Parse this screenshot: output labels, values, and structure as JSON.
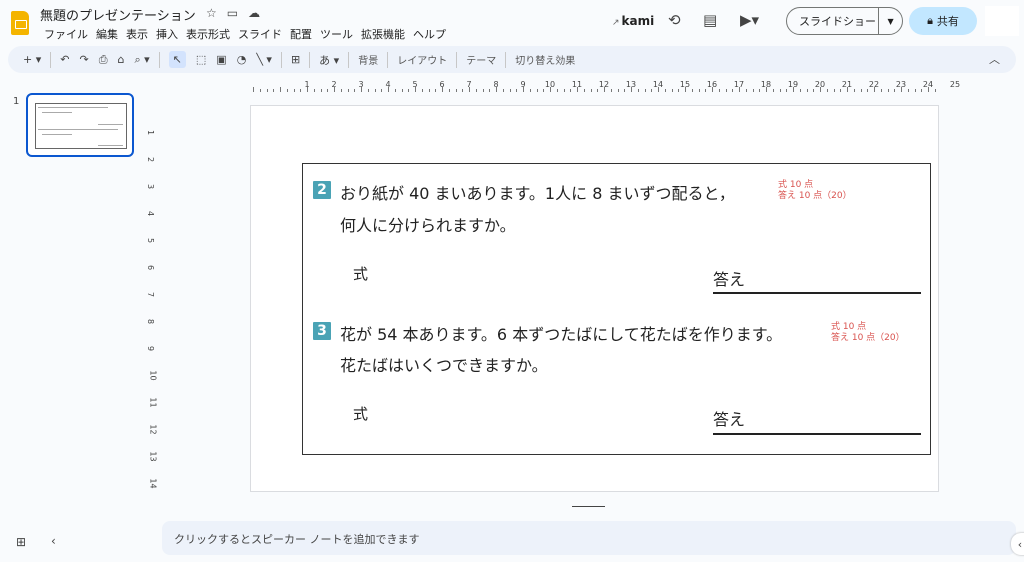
{
  "header": {
    "title": "無題のプレゼンテーション",
    "menu": [
      "ファイル",
      "編集",
      "表示",
      "挿入",
      "表示形式",
      "スライド",
      "配置",
      "ツール",
      "拡張機能",
      "ヘルプ"
    ],
    "kami_label": "kami",
    "slideshow_label": "スライドショー",
    "share_label": "共有"
  },
  "toolbar": {
    "background_label": "背景",
    "layout_label": "レイアウト",
    "theme_label": "テーマ",
    "transition_label": "切り替え効果",
    "text_btn": "あ"
  },
  "filmstrip": {
    "slide_number": "1"
  },
  "ruler": {
    "h": [
      "1",
      "1",
      "2",
      "3",
      "4",
      "5",
      "6",
      "7",
      "8",
      "9",
      "10",
      "11",
      "12",
      "13",
      "14",
      "15",
      "16",
      "17",
      "18",
      "19",
      "20",
      "21",
      "22",
      "23",
      "24",
      "25"
    ],
    "v": [
      "1",
      "2",
      "3",
      "4",
      "5",
      "6",
      "7",
      "8",
      "9",
      "10",
      "11",
      "12",
      "13",
      "14"
    ]
  },
  "slide": {
    "q2": {
      "num": "2",
      "line1": "おり紙が 40 まいあります。1人に 8 まいずつ配ると，",
      "line2": "何人に分けられますか。",
      "score1": "式 10 点",
      "score2": "答え 10 点（20）",
      "shiki": "式",
      "kotae": "答え"
    },
    "q3": {
      "num": "3",
      "line1": "花が 54 本あります。6 本ずつたばにして花たばを作ります。",
      "line2": "花たばはいくつできますか。",
      "score1": "式 10 点",
      "score2": "答え 10 点（20）",
      "shiki": "式",
      "kotae": "答え"
    }
  },
  "notes": {
    "placeholder": "クリックするとスピーカー ノートを追加できます"
  },
  "colors": {
    "accent": "#0b57d0",
    "share_bg": "#c2e7ff",
    "qnum": "#4aa3b5",
    "score": "#d9534f"
  }
}
